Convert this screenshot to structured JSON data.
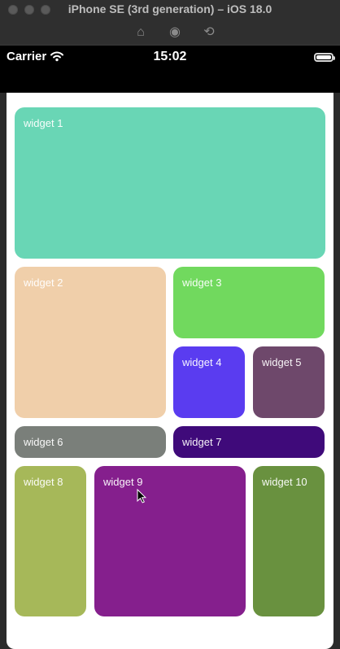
{
  "window": {
    "title": "iPhone SE (3rd generation) – iOS 18.0"
  },
  "icons": {
    "home": "home-icon",
    "camera": "camera-icon",
    "rotate": "rotate-icon",
    "wifi": "wifi-icon",
    "battery": "battery-icon",
    "cursor": "cursor-icon"
  },
  "status": {
    "carrier": "Carrier",
    "time": "15:02"
  },
  "widgets": [
    {
      "label": "widget 1",
      "color": "#69d6b5"
    },
    {
      "label": "widget 2",
      "color": "#f0cfaa"
    },
    {
      "label": "widget 3",
      "color": "#71d95e"
    },
    {
      "label": "widget 4",
      "color": "#5a3cf0"
    },
    {
      "label": "widget 5",
      "color": "#6e486b"
    },
    {
      "label": "widget 6",
      "color": "#7a7f7a"
    },
    {
      "label": "widget 7",
      "color": "#3f0a7a"
    },
    {
      "label": "widget 8",
      "color": "#a6b859"
    },
    {
      "label": "widget 9",
      "color": "#851f8d"
    },
    {
      "label": "widget 10",
      "color": "#69913f"
    }
  ]
}
